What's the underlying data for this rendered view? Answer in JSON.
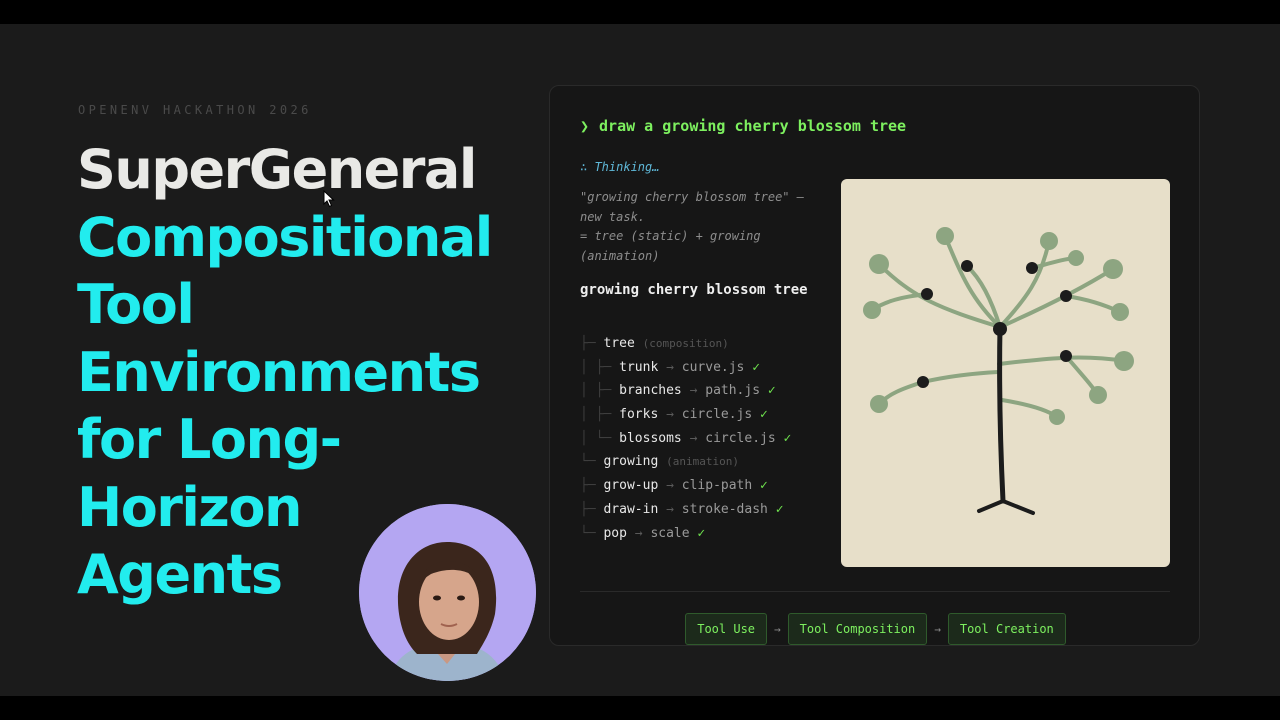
{
  "slide": {
    "eyebrow": "OPENENV HACKATHON 2026",
    "title_main": "SuperGeneral",
    "title_lines": [
      "Compositional",
      "Tool",
      "Environments",
      "for Long-",
      "Horizon",
      "Agents"
    ]
  },
  "panel": {
    "prompt_caret": "❯",
    "prompt": "draw a growing cherry blossom tree",
    "thinking": "∴ Thinking…",
    "reasoning": [
      "\"growing cherry blossom tree\" —",
      "new task.",
      "= tree (static) + growing",
      "(animation)"
    ],
    "plan_title": "growing cherry blossom tree",
    "tree": {
      "groups": [
        {
          "name": "tree",
          "kind": "(composition)",
          "items": [
            {
              "name": "trunk",
              "tool": "curve.js"
            },
            {
              "name": "branches",
              "tool": "path.js"
            },
            {
              "name": "forks",
              "tool": "circle.js"
            },
            {
              "name": "blossoms",
              "tool": "circle.js"
            }
          ]
        },
        {
          "name": "growing",
          "kind": "(animation)",
          "items": [
            {
              "name": "grow-up",
              "tool": "clip-path"
            },
            {
              "name": "draw-in",
              "tool": "stroke-dash"
            },
            {
              "name": "pop",
              "tool": "scale"
            }
          ]
        }
      ]
    },
    "arrow": "→",
    "check": "✓",
    "pipeline": [
      "Tool Use",
      "Tool Composition",
      "Tool Creation"
    ],
    "pipeline_sep": "→"
  },
  "colors": {
    "accent_cyan": "#22ecee",
    "accent_green": "#7df05f",
    "canvas_bg": "#e7dfc9",
    "blossom": "#8da581",
    "fork": "#1a1a1a"
  }
}
